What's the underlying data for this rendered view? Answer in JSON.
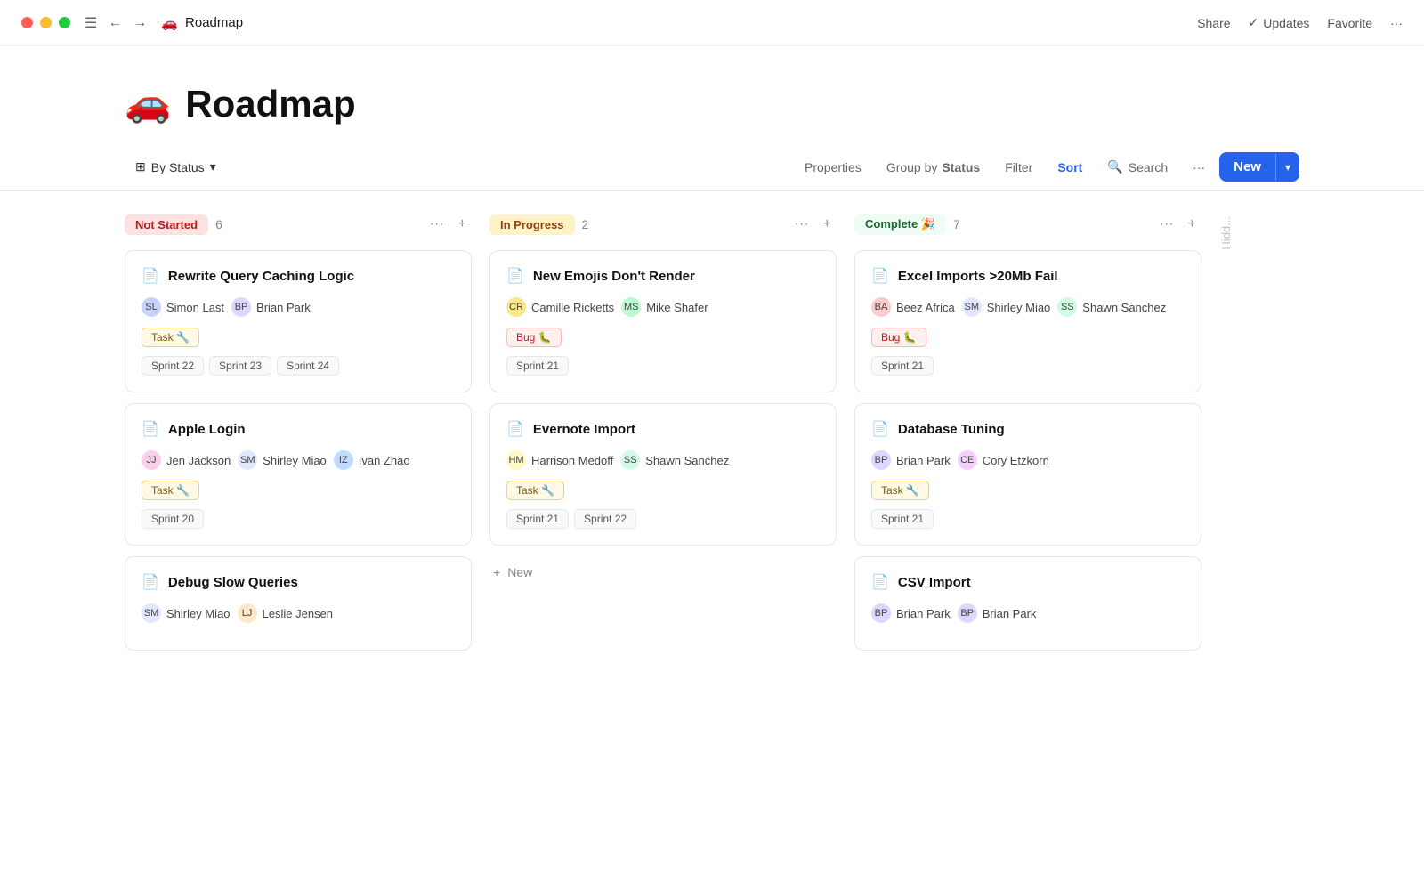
{
  "titlebar": {
    "title": "Roadmap",
    "emoji": "🚗",
    "share_label": "Share",
    "updates_label": "Updates",
    "favorite_label": "Favorite",
    "more_label": "···"
  },
  "toolbar": {
    "view_label": "By Status",
    "properties_label": "Properties",
    "group_by_label": "Group by",
    "group_by_value": "Status",
    "filter_label": "Filter",
    "sort_label": "Sort",
    "search_label": "Search",
    "more_label": "···",
    "new_label": "New"
  },
  "columns": [
    {
      "id": "not-started",
      "badge": "Not Started",
      "badge_class": "badge-not-started",
      "count": 6,
      "cards": [
        {
          "title": "Rewrite Query Caching Logic",
          "assignees": [
            {
              "name": "Simon Last",
              "class": "av-simon",
              "initials": "SL"
            },
            {
              "name": "Brian Park",
              "class": "av-brian",
              "initials": "BP"
            }
          ],
          "tag": "Task 🔧",
          "tag_class": "tag-task",
          "sprints": [
            "Sprint 22",
            "Sprint 23",
            "Sprint 24"
          ]
        },
        {
          "title": "Apple Login",
          "assignees": [
            {
              "name": "Jen Jackson",
              "class": "av-jen",
              "initials": "JJ"
            },
            {
              "name": "Shirley Miao",
              "class": "av-shirley",
              "initials": "SM"
            },
            {
              "name": "Ivan Zhao",
              "class": "av-ivan",
              "initials": "IZ"
            }
          ],
          "tag": "Task 🔧",
          "tag_class": "tag-task",
          "sprints": [
            "Sprint 20"
          ]
        },
        {
          "title": "Debug Slow Queries",
          "assignees": [
            {
              "name": "Shirley Miao",
              "class": "av-shirley",
              "initials": "SM"
            },
            {
              "name": "Leslie Jensen",
              "class": "av-leslie",
              "initials": "LJ"
            }
          ],
          "tag": null,
          "tag_class": null,
          "sprints": []
        }
      ]
    },
    {
      "id": "in-progress",
      "badge": "In Progress",
      "badge_class": "badge-in-progress",
      "count": 2,
      "cards": [
        {
          "title": "New Emojis Don't Render",
          "assignees": [
            {
              "name": "Camille Ricketts",
              "class": "av-camille",
              "initials": "CR"
            },
            {
              "name": "Mike Shafer",
              "class": "av-mike",
              "initials": "MS"
            }
          ],
          "tag": "Bug 🐛",
          "tag_class": "tag-bug",
          "sprints": [
            "Sprint 21"
          ]
        },
        {
          "title": "Evernote Import",
          "assignees": [
            {
              "name": "Harrison Medoff",
              "class": "av-harrison",
              "initials": "HM"
            },
            {
              "name": "Shawn Sanchez",
              "class": "av-shawn",
              "initials": "SS"
            }
          ],
          "tag": "Task 🔧",
          "tag_class": "tag-task",
          "sprints": [
            "Sprint 21",
            "Sprint 22"
          ]
        }
      ],
      "show_new": true,
      "new_label": "+ New"
    },
    {
      "id": "complete",
      "badge": "Complete 🎉",
      "badge_class": "badge-complete",
      "count": 7,
      "cards": [
        {
          "title": "Excel Imports >20Mb Fail",
          "assignees": [
            {
              "name": "Beez Africa",
              "class": "av-beez",
              "initials": "BA"
            },
            {
              "name": "Shirley Miao",
              "class": "av-shirley",
              "initials": "SM"
            },
            {
              "name": "Shawn Sanchez",
              "class": "av-shawn",
              "initials": "SS"
            }
          ],
          "tag": "Bug 🐛",
          "tag_class": "tag-bug",
          "sprints": [
            "Sprint 21"
          ]
        },
        {
          "title": "Database Tuning",
          "assignees": [
            {
              "name": "Brian Park",
              "class": "av-brian",
              "initials": "BP"
            },
            {
              "name": "Cory Etzkorn",
              "class": "av-cory",
              "initials": "CE"
            }
          ],
          "tag": "Task 🔧",
          "tag_class": "tag-task",
          "sprints": [
            "Sprint 21"
          ]
        },
        {
          "title": "CSV Import",
          "assignees": [
            {
              "name": "Brian Park",
              "class": "av-brian",
              "initials": "BP"
            },
            {
              "name": "Brian Park",
              "class": "av-brian",
              "initials": "BP"
            }
          ],
          "tag": null,
          "tag_class": null,
          "sprints": []
        }
      ]
    },
    {
      "id": "hidden",
      "badge": "Hidd...",
      "is_hidden": true
    }
  ]
}
